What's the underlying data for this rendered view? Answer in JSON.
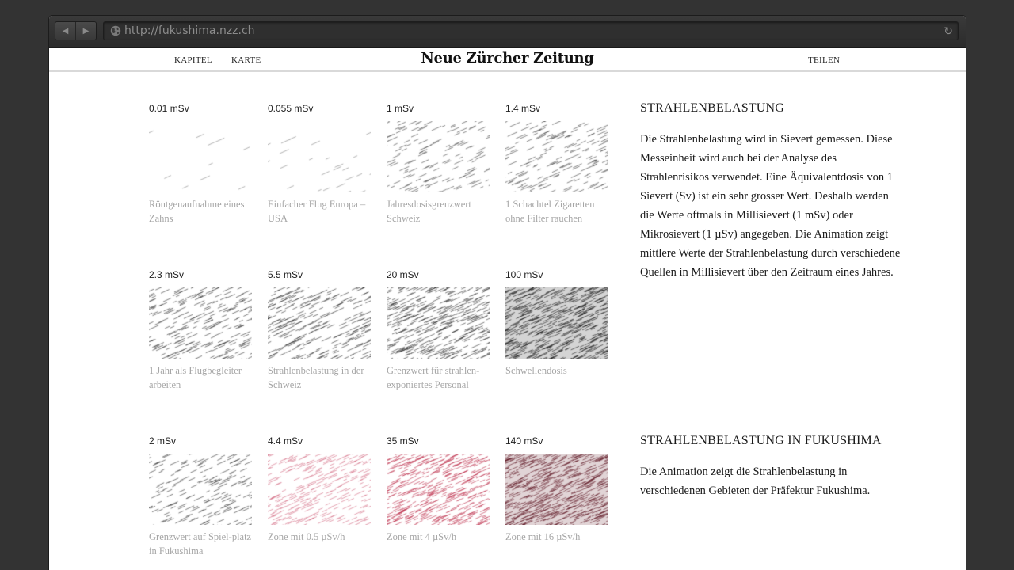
{
  "browser": {
    "url": "http://fukushima.nzz.ch",
    "back_label": "◀",
    "forward_label": "▶",
    "reload_label": "↻",
    "globe_icon": "globe-icon"
  },
  "site": {
    "nav_kapitel": "KAPITEL",
    "nav_karte": "KARTE",
    "logo": "Neue Zürcher Zeitung",
    "nav_teilen": "TEILEN"
  },
  "grid": [
    {
      "value": "0.01 mSv",
      "caption": "Röntgenaufnahme eines Zahns",
      "color": "#333333",
      "density": 0.01
    },
    {
      "value": "0.055 mSv",
      "caption": "Einfacher Flug Europa – USA",
      "color": "#333333",
      "density": 0.055
    },
    {
      "value": "1 mSv",
      "caption": "Jahresdosisgrenzwert Schweiz",
      "color": "#333333",
      "density": 1
    },
    {
      "value": "1.4 mSv",
      "caption": "1 Schachtel Zigaretten ohne Filter rauchen",
      "color": "#333333",
      "density": 1.4
    },
    {
      "value": "2.3 mSv",
      "caption": "1 Jahr als Flugbegleiter arbeiten",
      "color": "#222222",
      "density": 2.3
    },
    {
      "value": "5.5 mSv",
      "caption": "Strahlenbelastung in der Schweiz",
      "color": "#222222",
      "density": 5.5
    },
    {
      "value": "20 mSv",
      "caption": "Grenzwert für strahlen-exponiertes Personal",
      "color": "#222222",
      "density": 20
    },
    {
      "value": "100 mSv",
      "caption": "Schwellendosis",
      "color": "#111111",
      "density": 100
    },
    {
      "value": "2 mSv",
      "caption": "Grenzwert auf Spiel-platz in Fukushima",
      "color": "#222222",
      "density": 2
    },
    {
      "value": "4.4 mSv",
      "caption": "Zone mit 0.5 µSv/h",
      "color": "#d0607a",
      "density": 4.4
    },
    {
      "value": "35 mSv",
      "caption": "Zone mit 4 µSv/h",
      "color": "#b8203f",
      "density": 35
    },
    {
      "value": "140 mSv",
      "caption": "Zone mit 16 µSv/h",
      "color": "#5a0f1c",
      "density": 140
    }
  ],
  "section1": {
    "title": "STRAHLENBELASTUNG",
    "text": "Die Strahlenbelastung wird in Sievert gemessen. Diese Messeinheit wird auch bei der Analyse des Strahlenrisikos verwendet. Eine Äquivalentdosis von 1 Sievert (Sv) ist ein sehr grosser Wert. Deshalb werden die Werte oftmals in Millisievert (1 mSv) oder Mikrosievert (1 µSv) angegeben. Die Animation zeigt mittlere Werte der Strahlenbelastung durch verschiedene Quellen in Millisievert über den Zeitraum eines Jahres."
  },
  "section2": {
    "title": "STRAHLENBELASTUNG IN FUKUSHIMA",
    "text": "Die Animation zeigt die Strahlenbelastung in verschiedenen Gebieten der Präfektur Fukushima."
  }
}
